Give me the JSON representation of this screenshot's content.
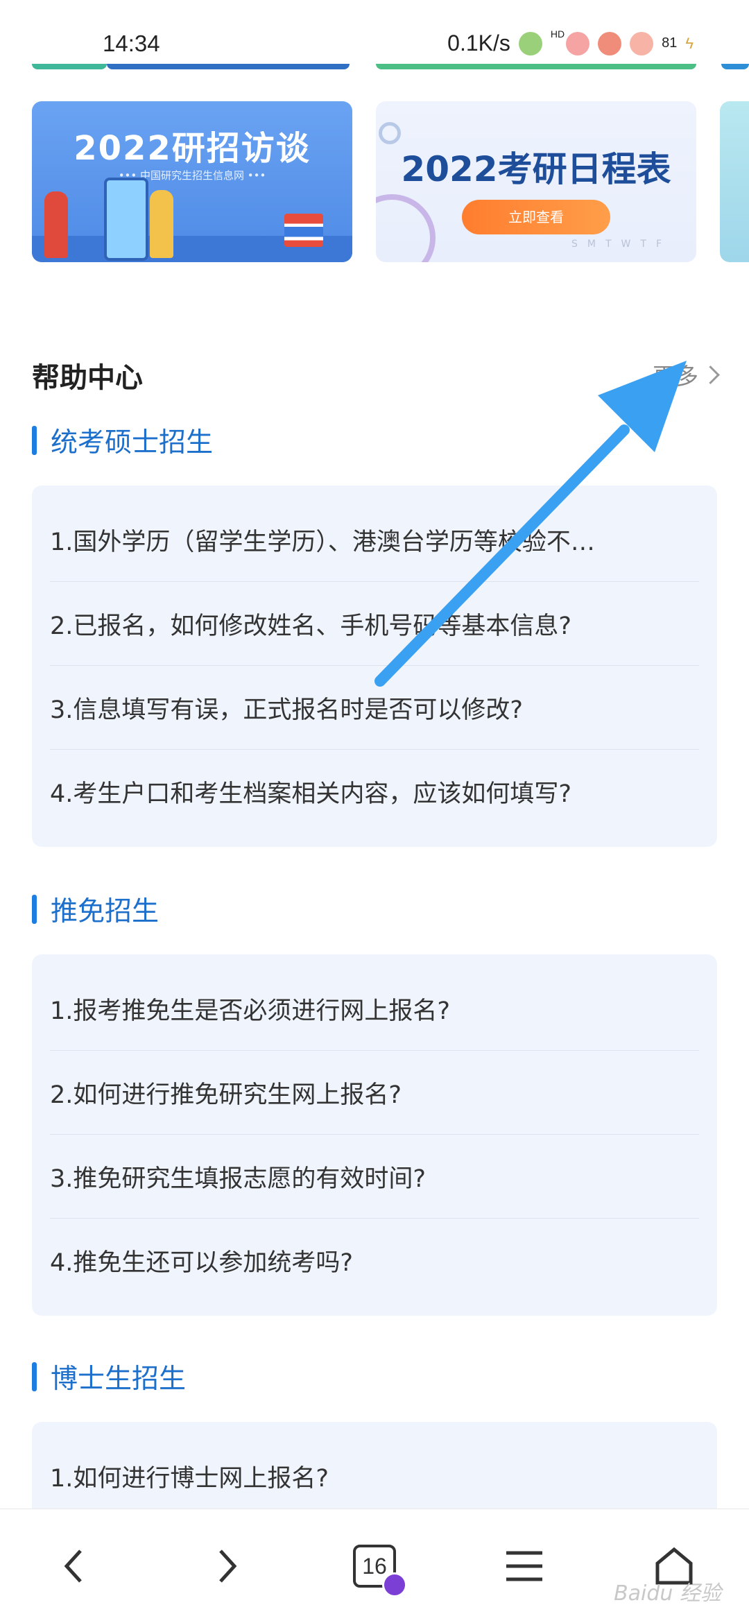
{
  "status_bar": {
    "time": "14:34",
    "net_speed": "0.1K/s",
    "hd": "HD",
    "battery": "81"
  },
  "banners": [
    {
      "title": "2022研招访谈",
      "subtitle": "••• 中国研究生招生信息网 •••"
    },
    {
      "title": "2022考研日程表",
      "button": "立即查看",
      "weekdays": "SMTWTF"
    }
  ],
  "help_center": {
    "title": "帮助中心",
    "more": "更多"
  },
  "sections": [
    {
      "label": "统考硕士招生",
      "questions": [
        "1.国外学历（留学生学历）、港澳台学历等校验不…",
        "2.已报名，如何修改姓名、手机号码等基本信息?",
        "3.信息填写有误，正式报名时是否可以修改?",
        "4.考生户口和考生档案相关内容，应该如何填写?"
      ]
    },
    {
      "label": "推免招生",
      "questions": [
        "1.报考推免生是否必须进行网上报名?",
        "2.如何进行推免研究生网上报名?",
        "3.推免研究生填报志愿的有效时间?",
        "4.推免生还可以参加统考吗?"
      ]
    },
    {
      "label": "博士生招生",
      "questions": [
        "1.如何进行博士网上报名?"
      ]
    }
  ],
  "bottom_nav": {
    "tab_count": "16",
    "watermark": "Baidu 经验"
  },
  "colors": {
    "accent": "#1d7de0",
    "arrow": "#3aa0f2",
    "card_bg": "#f0f5fd"
  }
}
